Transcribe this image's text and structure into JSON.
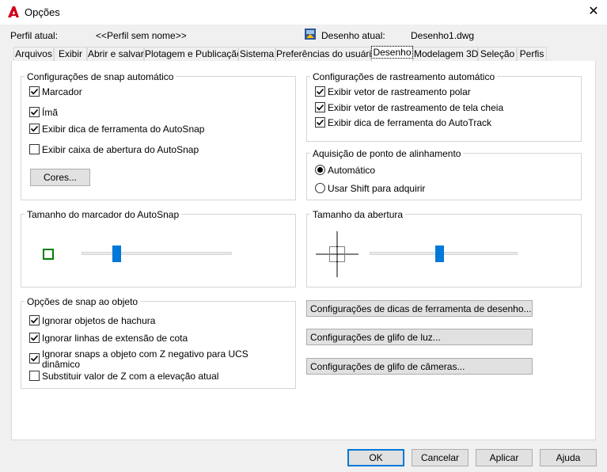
{
  "window": {
    "title": "Opções",
    "close_glyph": "✕"
  },
  "header": {
    "profile_label": "Perfil atual:",
    "profile_value": "<<Perfil sem nome>>",
    "drawing_label": "Desenho atual:",
    "drawing_value": "Desenho1.dwg"
  },
  "tabs": [
    {
      "label": "Arquivos"
    },
    {
      "label": "Exibir"
    },
    {
      "label": "Abrir e salvar"
    },
    {
      "label": "Plotagem e Publicação"
    },
    {
      "label": "Sistema"
    },
    {
      "label": "Preferências do usuário"
    },
    {
      "label": "Desenho",
      "active": true
    },
    {
      "label": "Modelagem 3D"
    },
    {
      "label": "Seleção"
    },
    {
      "label": "Perfis"
    }
  ],
  "autosnap": {
    "title": "Configurações de snap automático",
    "items": [
      {
        "label": "Marcador",
        "checked": true
      },
      {
        "label": "Ímã",
        "checked": true
      },
      {
        "label": "Exibir dica de ferramenta do AutoSnap",
        "checked": true
      },
      {
        "label": "Exibir caixa de abertura do AutoSnap",
        "checked": false
      }
    ],
    "colors_button": "Cores..."
  },
  "autotrack": {
    "title": "Configurações de rastreamento automático",
    "items": [
      {
        "label": "Exibir vetor de rastreamento polar",
        "checked": true
      },
      {
        "label": "Exibir vetor de rastreamento de tela cheia",
        "checked": true
      },
      {
        "label": "Exibir dica de ferramenta do AutoTrack",
        "checked": true
      }
    ]
  },
  "alignment": {
    "title": "Aquisição de ponto de alinhamento",
    "options": [
      {
        "label": "Automático",
        "selected": true
      },
      {
        "label": "Usar Shift para adquirir",
        "selected": false
      }
    ]
  },
  "marker_size": {
    "title": "Tamanho do marcador do AutoSnap",
    "marker_color": "#008000",
    "slider_fraction": 0.23
  },
  "aperture_size": {
    "title": "Tamanho da abertura",
    "slider_fraction": 0.47
  },
  "object_snap": {
    "title": "Opções de snap ao objeto",
    "items": [
      {
        "label": "Ignorar objetos de hachura",
        "checked": true
      },
      {
        "label": "Ignorar linhas de extensão de cota",
        "checked": true
      },
      {
        "label": "Ignorar snaps a objeto com Z negativo para UCS dinâmico",
        "line1": "Ignorar snaps a objeto com Z negativo para UCS",
        "line2": "dinâmico",
        "checked": true
      },
      {
        "label": "Substituir valor de Z com a elevação atual",
        "checked": false
      }
    ]
  },
  "settings_buttons": [
    "Configurações de dicas de ferramenta de desenho...",
    "Configurações de glifo de luz...",
    "Configurações de glifo de câmeras..."
  ],
  "footer": {
    "ok": "OK",
    "cancel": "Cancelar",
    "apply": "Aplicar",
    "help": "Ajuda"
  },
  "colors": {
    "accent": "#0078d7",
    "app_icon": "#d0001b"
  }
}
